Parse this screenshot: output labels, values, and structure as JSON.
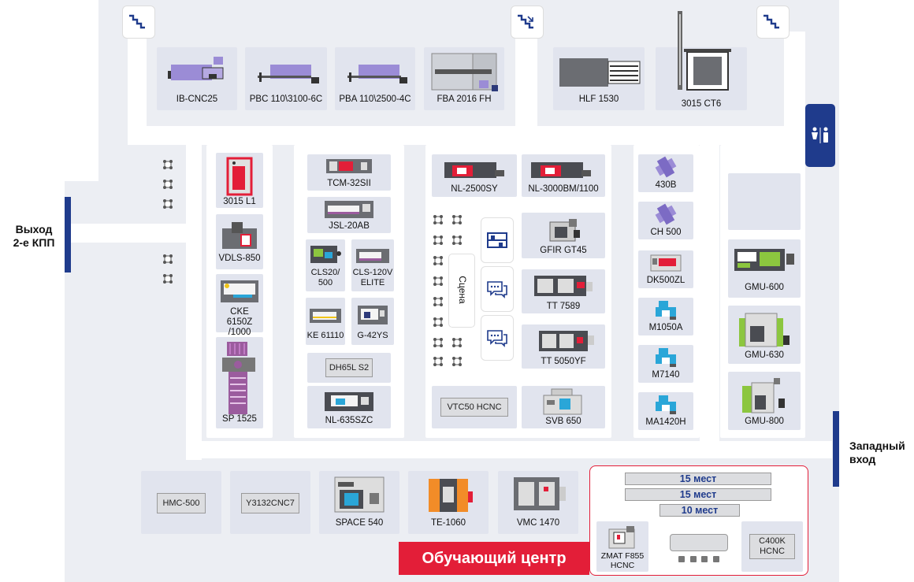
{
  "exits": {
    "left": "Выход 2-е КПП",
    "right": "Западный вход"
  },
  "stage": "Сцена",
  "training": {
    "title": "Обучающий центр",
    "rows": [
      "15 мест",
      "15 мест",
      "10 мест"
    ],
    "machines": [
      "ZMAT F855 HCNC",
      "C400K HCNC"
    ]
  },
  "top_row": [
    "IB-CNC25",
    "PBC 110\\3100-6C",
    "PBA 110\\2500-4C",
    "FBA 2016 FH",
    "HLF 1530",
    "3015 CT6"
  ],
  "col1": [
    "3015 L1",
    "VDLS-850",
    "CKE 6150Z /1000",
    "SP 1525"
  ],
  "col2": [
    "TCM-32SII",
    "JSL-20AB",
    "CLS20/ 500",
    "CLS-120V ELITE",
    "KE 61110",
    "G-42YS",
    "DH65L S2",
    "NL-635SZC"
  ],
  "col3": [
    "NL-2500SY",
    "NL-3000BM/1100",
    "GFIR GT45",
    "TT 7589",
    "TT 5050YF",
    "VTC50 HCNC",
    "SVB 650"
  ],
  "col4": [
    "430B",
    "CH 500",
    "DK500ZL",
    "M1050A",
    "M7140",
    "MA1420H"
  ],
  "col5": [
    "GMU-600",
    "GMU-630",
    "GMU-800"
  ],
  "bottom_row": [
    "HMC-500",
    "Y3132CNC7",
    "SPACE 540",
    "TE-1060",
    "VMC 1470"
  ],
  "colors": {
    "accent_red": "#e31e38",
    "navy": "#1f3b8c",
    "purple": "#9b8cd6",
    "green": "#8cc63f",
    "orange": "#f28c28",
    "cyan": "#2aa6d8"
  }
}
